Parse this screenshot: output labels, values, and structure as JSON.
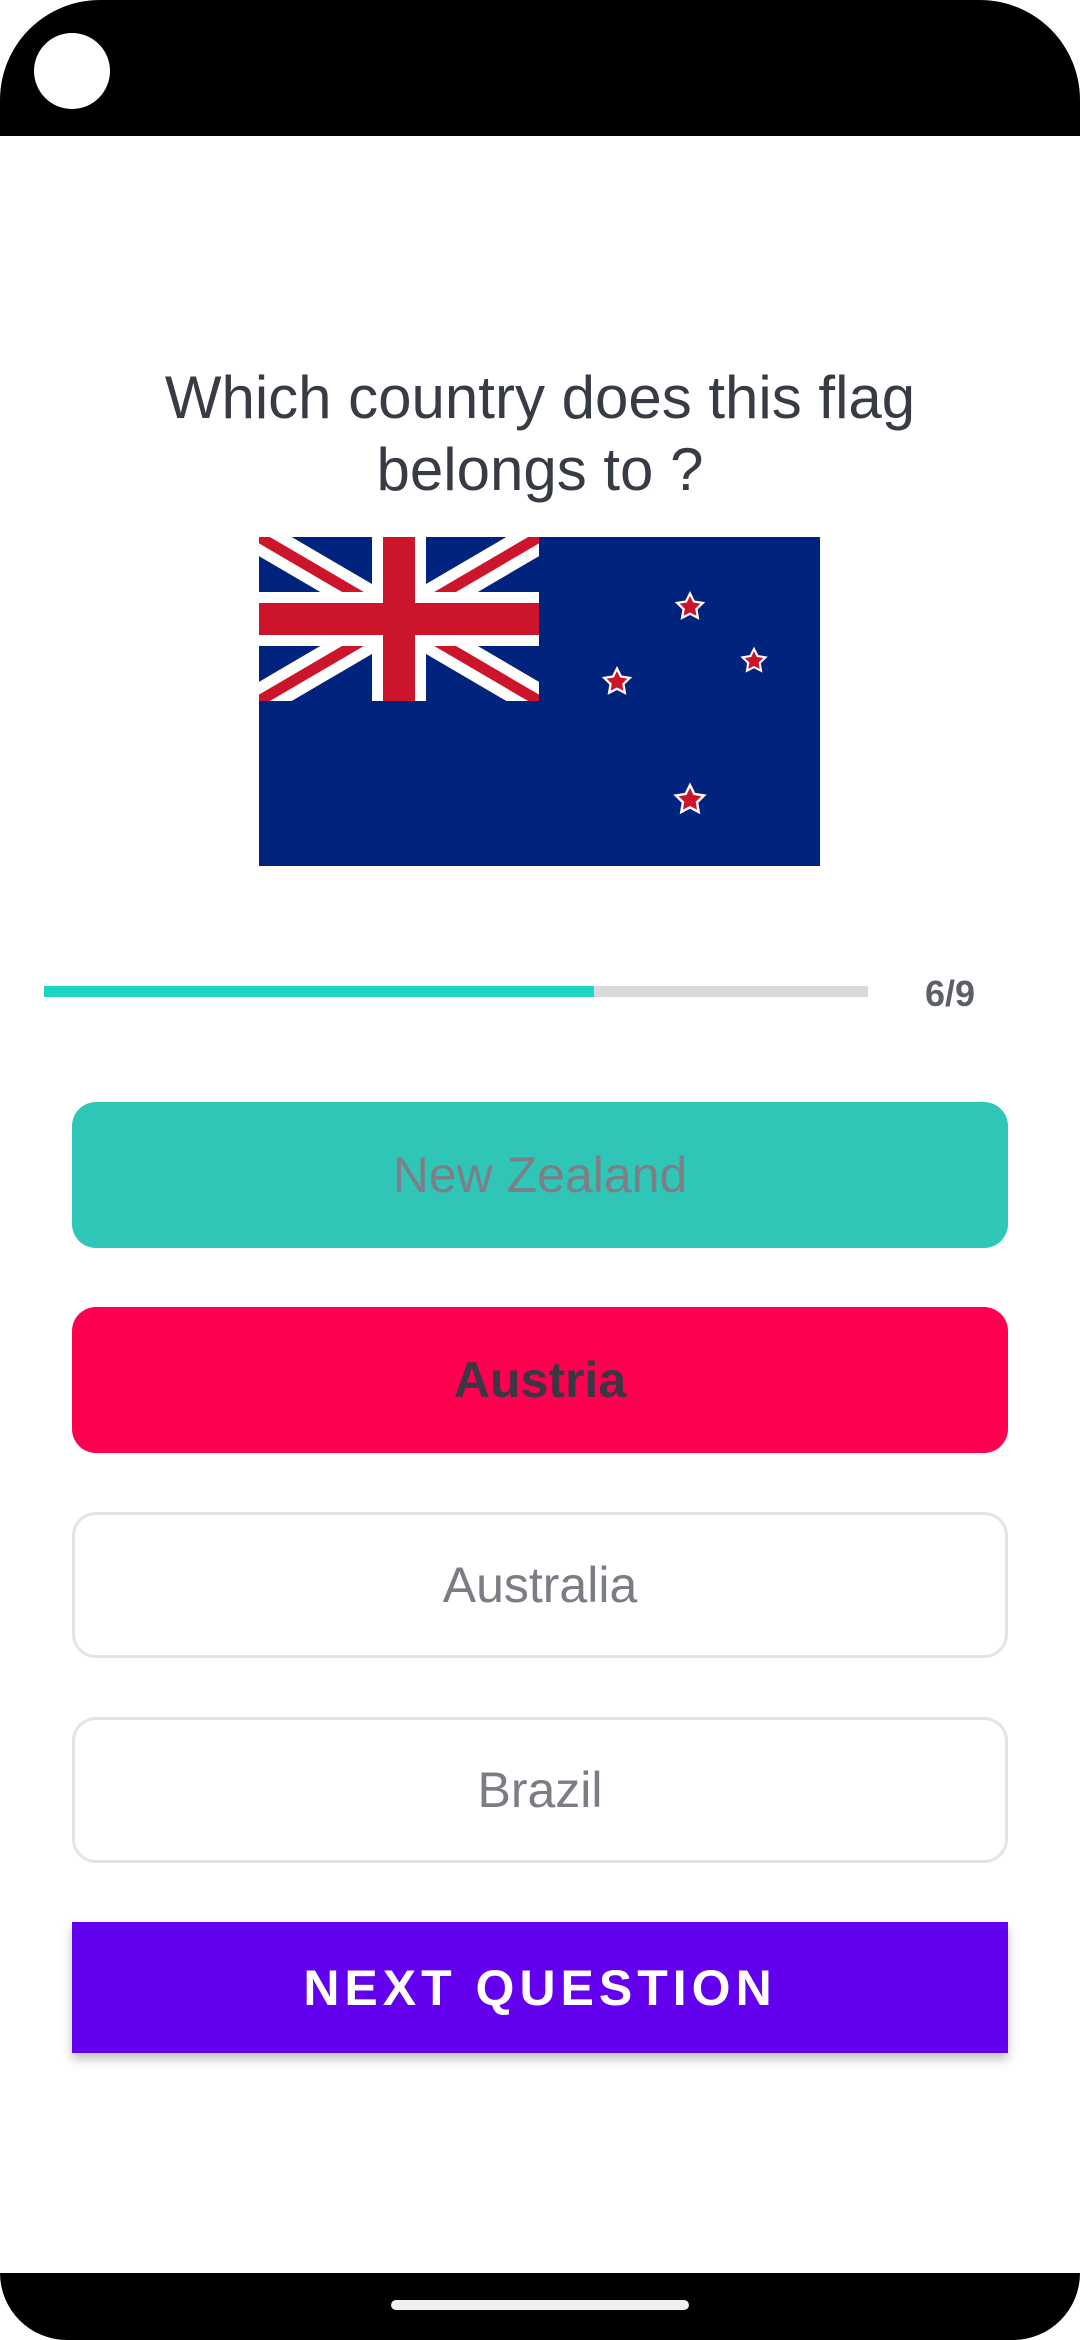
{
  "question": {
    "text": "Which country does this flag belongs to ?"
  },
  "flag": {
    "icon": "new-zealand-flag-icon",
    "colors": {
      "blue": "#00247d",
      "red": "#cc142b",
      "white": "#ffffff"
    }
  },
  "progress": {
    "label": "6/9",
    "current": 6,
    "total": 9,
    "fill_fraction": 0.667,
    "color": "#1fd3c6"
  },
  "options": [
    {
      "label": "New Zealand",
      "state": "correct",
      "color": "#2fc6b7"
    },
    {
      "label": "Austria",
      "state": "wrong-selected",
      "color": "#ff0050"
    },
    {
      "label": "Australia",
      "state": "neutral"
    },
    {
      "label": "Brazil",
      "state": "neutral"
    }
  ],
  "next_button": {
    "label": "NEXT QUESTION",
    "color": "#6300ee"
  }
}
